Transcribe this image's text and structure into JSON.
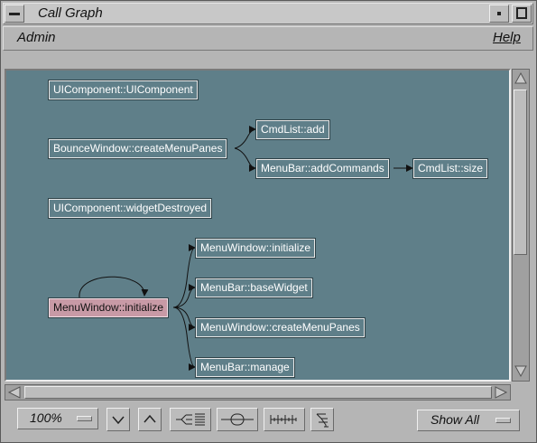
{
  "window": {
    "title": "Call Graph"
  },
  "menubar": {
    "admin": "Admin",
    "help": "Help"
  },
  "graph": {
    "nodes": {
      "n_uicomp": "UIComponent::UIComponent",
      "n_bounce": "BounceWindow::createMenuPanes",
      "n_cmdadd": "CmdList::add",
      "n_addcmds": "MenuBar::addCommands",
      "n_cmdsize": "CmdList::size",
      "n_destroyed": "UIComponent::widgetDestroyed",
      "n_mwinit_t": "MenuWindow::initialize",
      "n_basewidget": "MenuBar::baseWidget",
      "n_mwinit_s": "MenuWindow::initialize",
      "n_createpanes": "MenuWindow::createMenuPanes",
      "n_manage": "MenuBar::manage"
    },
    "selected_node": "n_mwinit_s",
    "colors": {
      "canvas": "#5f7f89",
      "selected": "#c89aa6",
      "edge": "#111111"
    }
  },
  "toolbar": {
    "zoom": "100%",
    "show_all": "Show All",
    "buttons": [
      "chevron-down-icon",
      "chevron-up-icon",
      "tree-collapse-icon",
      "node-center-icon",
      "vertical-layout-icon",
      "arrange-icon"
    ]
  }
}
